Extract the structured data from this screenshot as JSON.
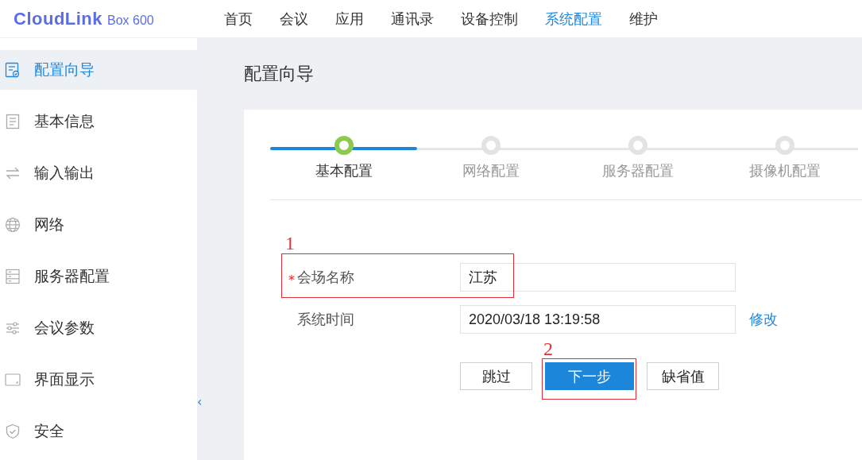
{
  "header": {
    "logo": "CloudLink",
    "model": "Box 600",
    "nav": [
      {
        "label": "首页",
        "selected": false
      },
      {
        "label": "会议",
        "selected": false
      },
      {
        "label": "应用",
        "selected": false
      },
      {
        "label": "通讯录",
        "selected": false
      },
      {
        "label": "设备控制",
        "selected": false
      },
      {
        "label": "系统配置",
        "selected": true
      },
      {
        "label": "维护",
        "selected": false
      }
    ]
  },
  "sidebar": {
    "items": [
      {
        "label": "配置向导",
        "selected": true
      },
      {
        "label": "基本信息",
        "selected": false
      },
      {
        "label": "输入输出",
        "selected": false
      },
      {
        "label": "网络",
        "selected": false
      },
      {
        "label": "服务器配置",
        "selected": false
      },
      {
        "label": "会议参数",
        "selected": false
      },
      {
        "label": "界面显示",
        "selected": false
      },
      {
        "label": "安全",
        "selected": false
      }
    ],
    "collapse": "‹"
  },
  "page_title": "配置向导",
  "steps": [
    {
      "label": "基本配置",
      "selected": true
    },
    {
      "label": "网络配置",
      "selected": false
    },
    {
      "label": "服务器配置",
      "selected": false
    },
    {
      "label": "摄像机配置",
      "selected": false
    }
  ],
  "form": [
    {
      "label": "会场名称",
      "required_mark": "*",
      "value": "江苏"
    },
    {
      "label": "系统时间",
      "value": "2020/03/18 13:19:58",
      "link": "修改"
    }
  ],
  "buttons": [
    {
      "label": "跳过",
      "kind": "default"
    },
    {
      "label": "下一步",
      "kind": "primary"
    },
    {
      "label": "缺省值",
      "kind": "default"
    }
  ],
  "annotations": [
    {
      "label": "1"
    },
    {
      "label": "2"
    }
  ]
}
